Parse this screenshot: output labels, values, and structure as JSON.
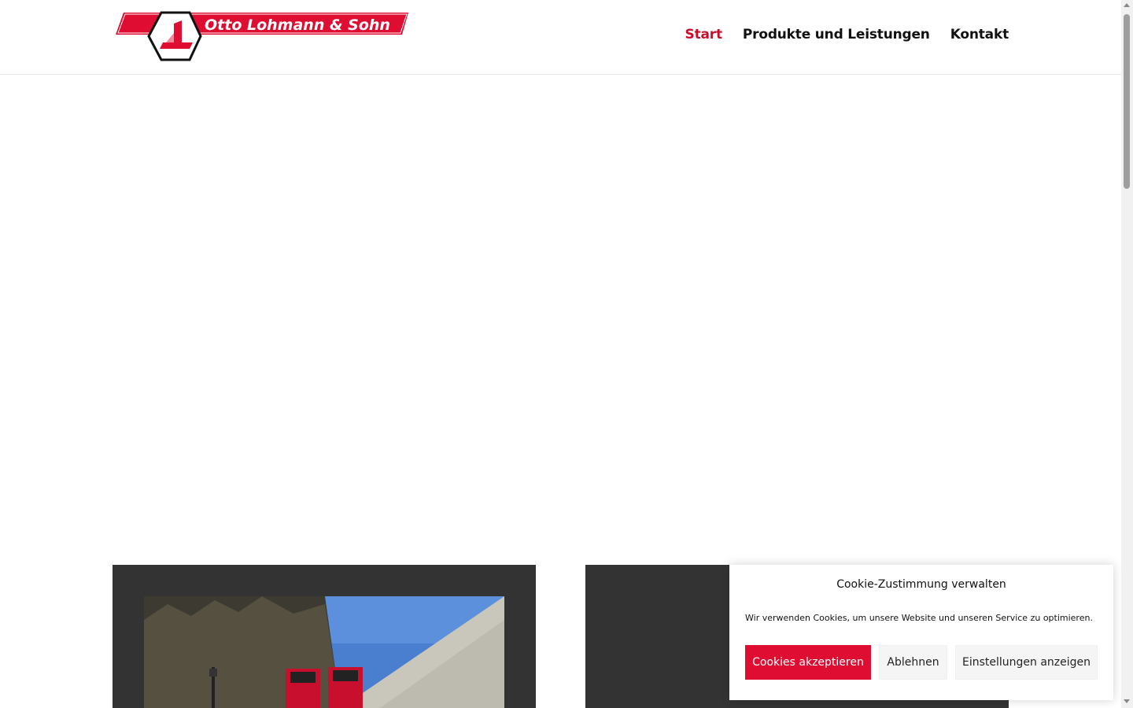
{
  "header": {
    "logo_text": "Otto Lohmann & Sohn",
    "nav": [
      {
        "label": "Start",
        "active": true
      },
      {
        "label": "Produkte und Leistungen",
        "active": false
      },
      {
        "label": "Kontakt",
        "active": false
      }
    ]
  },
  "colors": {
    "brand_red": "#df0d32",
    "nav_active": "#c8102e",
    "card_background": "#333333"
  },
  "cookie_banner": {
    "title": "Cookie-Zustimmung verwalten",
    "text": "Wir verwenden Cookies, um unsere Website und unseren Service zu optimieren.",
    "accept_label": "Cookies akzeptieren",
    "deny_label": "Ablehnen",
    "preferences_label": "Einstellungen anzeigen"
  }
}
